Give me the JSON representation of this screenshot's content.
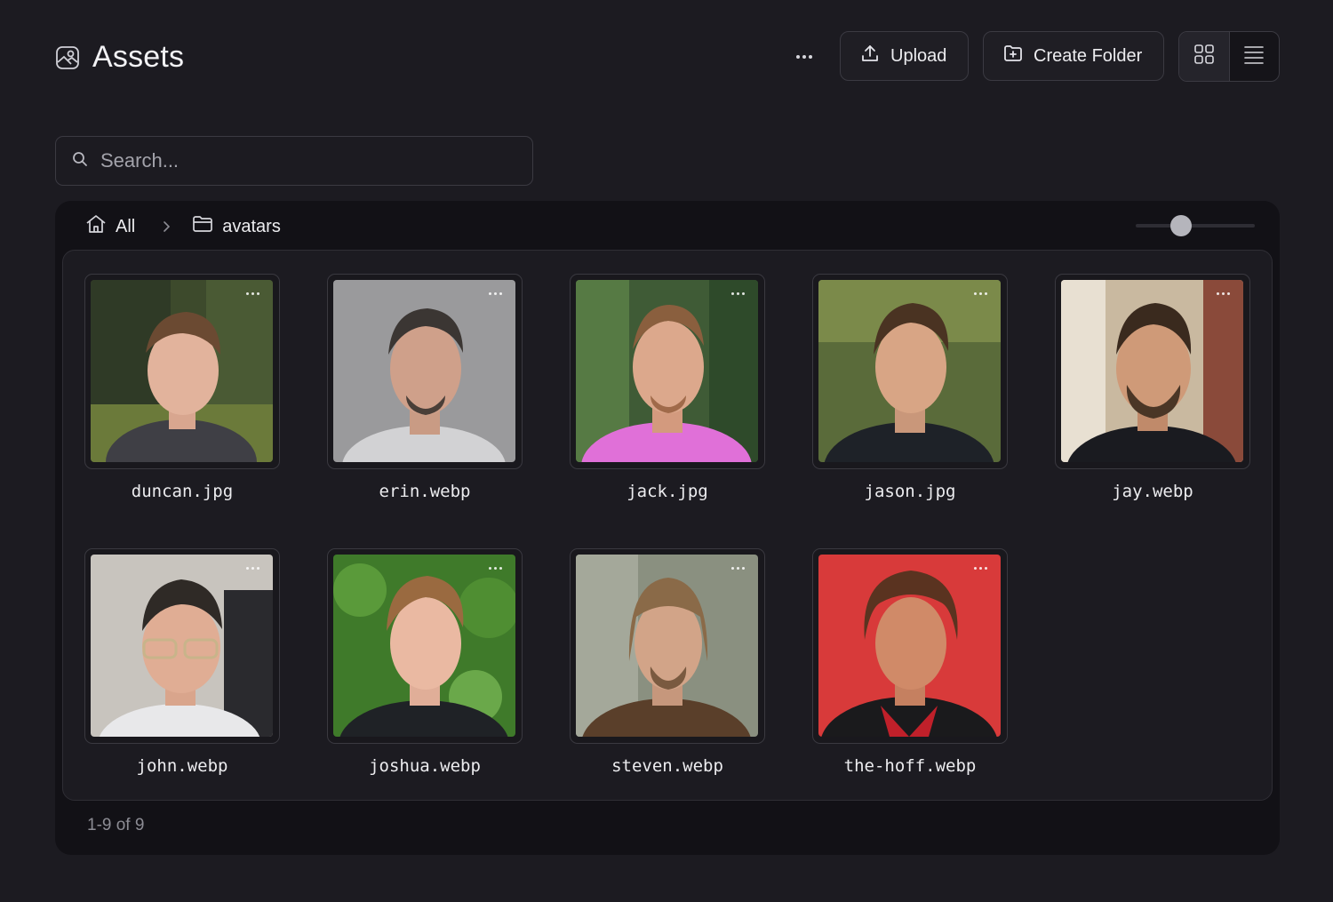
{
  "header": {
    "title": "Assets",
    "upload_label": "Upload",
    "create_folder_label": "Create Folder",
    "view_mode": "grid"
  },
  "search": {
    "placeholder": "Search..."
  },
  "breadcrumb": {
    "root": "All",
    "current": "avatars"
  },
  "zoom_slider": {
    "value_fraction": 0.35
  },
  "assets": [
    {
      "name": "duncan.jpg"
    },
    {
      "name": "erin.webp"
    },
    {
      "name": "jack.jpg"
    },
    {
      "name": "jason.jpg"
    },
    {
      "name": "jay.webp"
    },
    {
      "name": "john.webp"
    },
    {
      "name": "joshua.webp"
    },
    {
      "name": "steven.webp"
    },
    {
      "name": "the-hoff.webp"
    }
  ],
  "pager": {
    "text": "1-9 of 9"
  },
  "colors": {
    "background": "#1c1b21",
    "panel": "#121116",
    "border": "#3b3a42",
    "text": "#ececef",
    "muted": "#8c8c94"
  }
}
